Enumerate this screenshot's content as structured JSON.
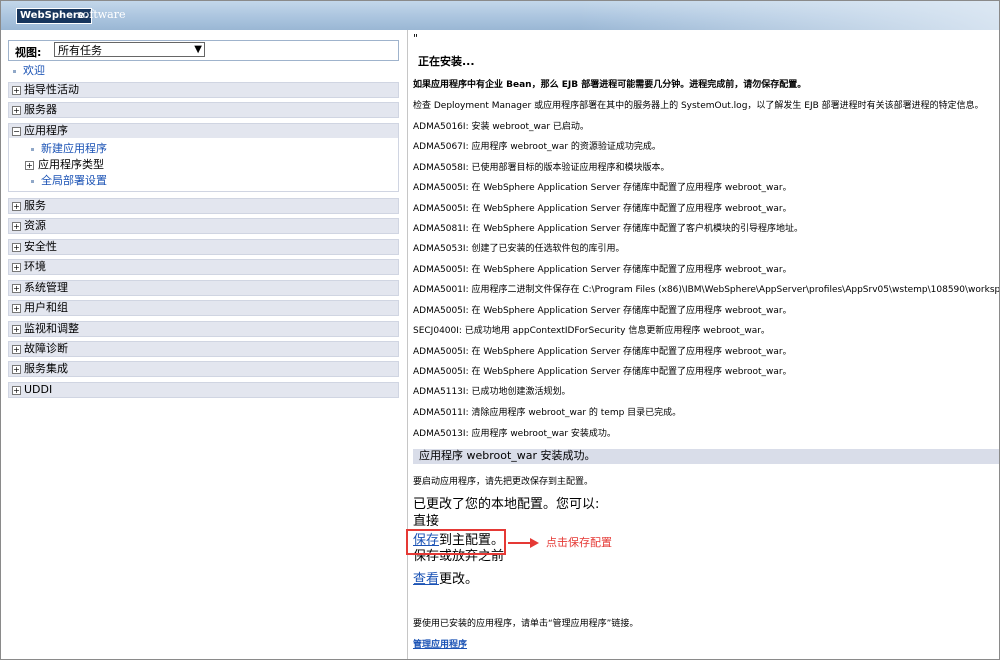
{
  "header": {
    "brand": "WebSphere.",
    "suffix": "software",
    "accent": "#17355c"
  },
  "nav": {
    "view_label": "视图:",
    "view_value": "所有任务",
    "welcome": "欢迎",
    "categories_top": [
      {
        "label": "指导性活动"
      },
      {
        "label": "服务器"
      }
    ],
    "applications": {
      "label": "应用程序",
      "children": [
        {
          "label": "新建应用程序"
        },
        {
          "label": "应用程序类型"
        },
        {
          "label": "全局部署设置"
        }
      ]
    },
    "categories_bottom": [
      {
        "label": "服务"
      },
      {
        "label": "资源"
      },
      {
        "label": "安全性"
      },
      {
        "label": "环境"
      },
      {
        "label": "系统管理"
      },
      {
        "label": "用户和组"
      },
      {
        "label": "监视和调整"
      },
      {
        "label": "故障诊断"
      },
      {
        "label": "服务集成"
      },
      {
        "label": "UDDI"
      }
    ]
  },
  "content": {
    "quote": "\"",
    "installing": "正在安装...",
    "notice_bold": "如果应用程序中有企业 Bean，那么 EJB 部署进程可能需要几分钟。进程完成前，请勿保存配置。",
    "check": "检查 Deployment Manager 或应用程序部署在其中的服务器上的 SystemOut.log，以了解发生 EJB 部署进程时有关该部署进程的特定信息。",
    "log": [
      "ADMA5016I: 安装 webroot_war 已启动。",
      "ADMA5067I: 应用程序 webroot_war 的资源验证成功完成。",
      "ADMA5058I: 已使用部署目标的版本验证应用程序和模块版本。",
      "ADMA5005I: 在 WebSphere Application Server 存储库中配置了应用程序 webroot_war。",
      "ADMA5005I: 在 WebSphere Application Server 存储库中配置了应用程序 webroot_war。",
      "ADMA5081I: 在 WebSphere Application Server 存储库中配置了客户机模块的引导程序地址。",
      "ADMA5053I: 创建了已安装的任选软件包的库引用。",
      "ADMA5005I: 在 WebSphere Application Server 存储库中配置了应用程序 webroot_war。",
      "ADMA5001I: 应用程序二进制文件保存在 C:\\Program Files (x86)\\IBM\\WebSphere\\AppServer\\profiles\\AppSrv05\\wstemp\\108590\\workspace\\c",
      "ADMA5005I: 在 WebSphere Application Server 存储库中配置了应用程序 webroot_war。",
      "SECJ0400I: 已成功地用 appContextIDForSecurity 信息更新应用程序 webroot_war。",
      "ADMA5005I: 在 WebSphere Application Server 存储库中配置了应用程序 webroot_war。",
      "ADMA5005I: 在 WebSphere Application Server 存储库中配置了应用程序 webroot_war。",
      "ADMA5113I: 已成功地创建激活规划。",
      "ADMA5011I: 清除应用程序 webroot_war 的 temp 目录已完成。",
      "ADMA5013I: 应用程序 webroot_war 安装成功。"
    ],
    "success": "应用程序 webroot_war 安装成功。",
    "start_hint": "要启动应用程序，请先把更改保存到主配置。",
    "changed": "已更改了您的本地配置。您可以:",
    "direct": "直接",
    "save_link": "保存",
    "save_rest": "到主配置。",
    "before": "保存或放弃之前",
    "review_link": "查看",
    "review_rest": "更改。",
    "manage_hint": "要使用已安装的应用程序，请单击“管理应用程序”链接。",
    "manage_link": "管理应用程序"
  },
  "annotation": {
    "text": "点击保存配置",
    "color": "#e53935"
  }
}
